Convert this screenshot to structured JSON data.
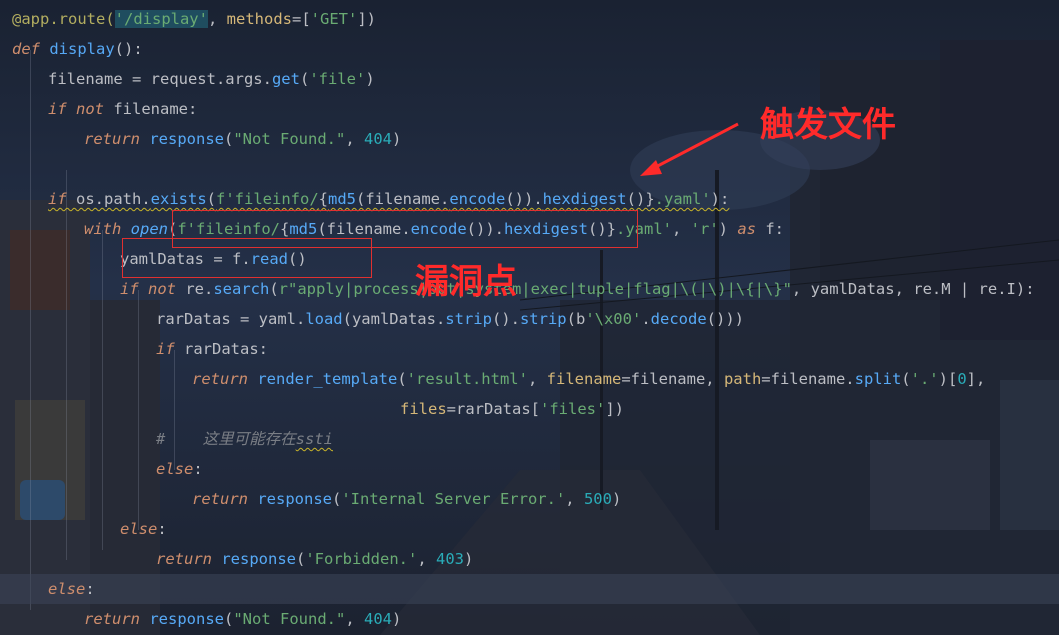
{
  "colors": {
    "background": "#1b2130",
    "keyword": "#cf8e6d",
    "string": "#6aab73",
    "number": "#2aacb8",
    "function": "#56a8f5",
    "decorator": "#b3ae60",
    "annotation_red": "#ff2a2a"
  },
  "code": {
    "lines": [
      {
        "tokens": [
          [
            "dec",
            "@app.route("
          ],
          [
            "route",
            "'/display'"
          ],
          [
            "plain",
            ", "
          ],
          [
            "param",
            "methods"
          ],
          [
            "plain",
            "=["
          ],
          [
            "str",
            "'GET'"
          ],
          [
            "plain",
            "])"
          ]
        ]
      },
      {
        "tokens": [
          [
            "kw",
            "def "
          ],
          [
            "fn",
            "display"
          ],
          [
            "plain",
            "():"
          ]
        ]
      },
      {
        "tokens": [
          [
            "plain",
            "filename = request.args."
          ],
          [
            "method",
            "get"
          ],
          [
            "plain",
            "("
          ],
          [
            "str",
            "'file'"
          ],
          [
            "plain",
            ")"
          ]
        ]
      },
      {
        "tokens": [
          [
            "kw",
            "if not "
          ],
          [
            "plain",
            "filename:"
          ]
        ]
      },
      {
        "tokens": [
          [
            "kw",
            "return "
          ],
          [
            "method",
            "response"
          ],
          [
            "plain",
            "("
          ],
          [
            "str",
            "\"Not Found.\""
          ],
          [
            "plain",
            ", "
          ],
          [
            "num",
            "404"
          ],
          [
            "plain",
            ")"
          ]
        ]
      },
      {
        "tokens": []
      },
      {
        "tokens": [
          [
            "kwsq",
            "if "
          ],
          [
            "sq",
            "os.path."
          ],
          [
            "sqm",
            "exists"
          ],
          [
            "sq",
            "("
          ],
          [
            "sqs",
            "f'fileinfo/"
          ],
          [
            "sq",
            "{"
          ],
          [
            "sqm",
            "md5"
          ],
          [
            "sq",
            "(filename."
          ],
          [
            "sqm",
            "encode"
          ],
          [
            "sq",
            "())."
          ],
          [
            "sqm",
            "hexdigest"
          ],
          [
            "sq",
            "()}"
          ],
          [
            "sqs",
            ".yaml'"
          ],
          [
            "sq",
            "):"
          ]
        ]
      },
      {
        "tokens": [
          [
            "kw",
            "with "
          ],
          [
            "kwm",
            "open"
          ],
          [
            "plain",
            "("
          ],
          [
            "str",
            "f'fileinfo/"
          ],
          [
            "plain",
            "{"
          ],
          [
            "method",
            "md5"
          ],
          [
            "plain",
            "(filename."
          ],
          [
            "method",
            "encode"
          ],
          [
            "plain",
            "())."
          ],
          [
            "method",
            "hexdigest"
          ],
          [
            "plain",
            "()}"
          ],
          [
            "str",
            ".yaml'"
          ],
          [
            "plain",
            ", "
          ],
          [
            "str",
            "'r'"
          ],
          [
            "plain",
            ") "
          ],
          [
            "kw",
            "as "
          ],
          [
            "plain",
            "f:"
          ]
        ]
      },
      {
        "tokens": [
          [
            "plain",
            "yamlDatas = f."
          ],
          [
            "method",
            "read"
          ],
          [
            "plain",
            "()"
          ]
        ]
      },
      {
        "tokens": [
          [
            "kw",
            "if not "
          ],
          [
            "plain",
            "re."
          ],
          [
            "method",
            "search"
          ],
          [
            "plain",
            "("
          ],
          [
            "str",
            "r\"apply|process|out|system|exec|tuple|flag|\\(|\\)|\\{|\\}\""
          ],
          [
            "plain",
            ", yamlDatas, re.M | re.I):"
          ]
        ]
      },
      {
        "tokens": [
          [
            "plain",
            "rarDatas = yaml."
          ],
          [
            "method",
            "load"
          ],
          [
            "plain",
            "(yamlDatas."
          ],
          [
            "method",
            "strip"
          ],
          [
            "plain",
            "()."
          ],
          [
            "method",
            "strip"
          ],
          [
            "plain",
            "(b"
          ],
          [
            "str",
            "'\\x00'"
          ],
          [
            "plain",
            "."
          ],
          [
            "method",
            "decode"
          ],
          [
            "plain",
            "()))"
          ]
        ]
      },
      {
        "tokens": [
          [
            "kw",
            "if "
          ],
          [
            "plain",
            "rarDatas:"
          ]
        ]
      },
      {
        "tokens": [
          [
            "kw",
            "return "
          ],
          [
            "method",
            "render_template"
          ],
          [
            "plain",
            "("
          ],
          [
            "str",
            "'result.html'"
          ],
          [
            "plain",
            ", "
          ],
          [
            "param",
            "filename"
          ],
          [
            "plain",
            "=filename, "
          ],
          [
            "param",
            "path"
          ],
          [
            "plain",
            "=filename."
          ],
          [
            "method",
            "split"
          ],
          [
            "plain",
            "("
          ],
          [
            "str",
            "'.'"
          ],
          [
            "plain",
            ")["
          ],
          [
            "num",
            "0"
          ],
          [
            "plain",
            "],"
          ]
        ]
      },
      {
        "tokens": [
          [
            "param",
            "files"
          ],
          [
            "plain",
            "=rarDatas["
          ],
          [
            "str",
            "'files'"
          ],
          [
            "plain",
            "])"
          ]
        ]
      },
      {
        "tokens": [
          [
            "comment",
            "#    这里可能存在"
          ],
          [
            "commentsq",
            "ssti"
          ]
        ]
      },
      {
        "tokens": [
          [
            "kw",
            "else"
          ],
          [
            "plain",
            ":"
          ]
        ]
      },
      {
        "tokens": [
          [
            "kw",
            "return "
          ],
          [
            "method",
            "response"
          ],
          [
            "plain",
            "("
          ],
          [
            "str",
            "'Internal Server Error.'"
          ],
          [
            "plain",
            ", "
          ],
          [
            "num",
            "500"
          ],
          [
            "plain",
            ")"
          ]
        ]
      },
      {
        "tokens": [
          [
            "kw",
            "else"
          ],
          [
            "plain",
            ":"
          ]
        ]
      },
      {
        "tokens": [
          [
            "kw",
            "return "
          ],
          [
            "method",
            "response"
          ],
          [
            "plain",
            "("
          ],
          [
            "str",
            "'Forbidden.'"
          ],
          [
            "plain",
            ", "
          ],
          [
            "num",
            "403"
          ],
          [
            "plain",
            ")"
          ]
        ]
      },
      {
        "tokens": [
          [
            "kw",
            "else"
          ],
          [
            "plain",
            ":"
          ]
        ]
      },
      {
        "tokens": [
          [
            "kw",
            "return "
          ],
          [
            "method",
            "response"
          ],
          [
            "plain",
            "("
          ],
          [
            "str",
            "\"Not Found.\""
          ],
          [
            "plain",
            ", "
          ],
          [
            "num",
            "404"
          ],
          [
            "plain",
            ")"
          ]
        ]
      }
    ]
  },
  "annotations": {
    "trigger_label": "触发文件",
    "vuln_label": "漏洞点"
  }
}
